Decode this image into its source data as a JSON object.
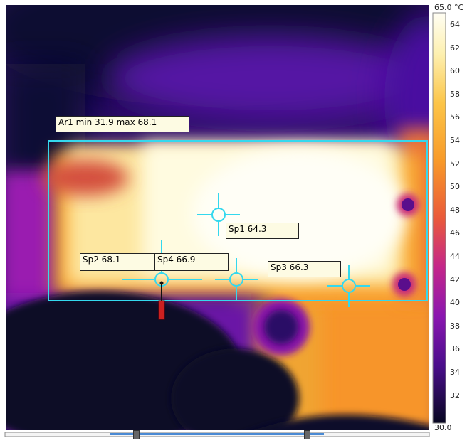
{
  "measurements": {
    "area": {
      "label": "Ar1 min 31.9 max 68.1"
    },
    "spots": [
      {
        "label": "Sp1 64.3"
      },
      {
        "label": "Sp2 68.1"
      },
      {
        "label": "Sp3 66.3"
      },
      {
        "label": "Sp4 66.9"
      }
    ]
  },
  "color_scale": {
    "max_label": "65.0 °C",
    "min_label": "30.0",
    "ticks": [
      "64",
      "62",
      "60",
      "58",
      "56",
      "54",
      "52",
      "50",
      "48",
      "46",
      "44",
      "42",
      "40",
      "38",
      "36",
      "34",
      "32"
    ],
    "palette": "iron",
    "colors": [
      "#0a0a2e",
      "#2a0a6a",
      "#5a10a0",
      "#8a14b0",
      "#c0208a",
      "#e84a3c",
      "#f7882a",
      "#fcb53a",
      "#fde08a",
      "#fffde8"
    ]
  },
  "overlay_color": "#34d8ee"
}
